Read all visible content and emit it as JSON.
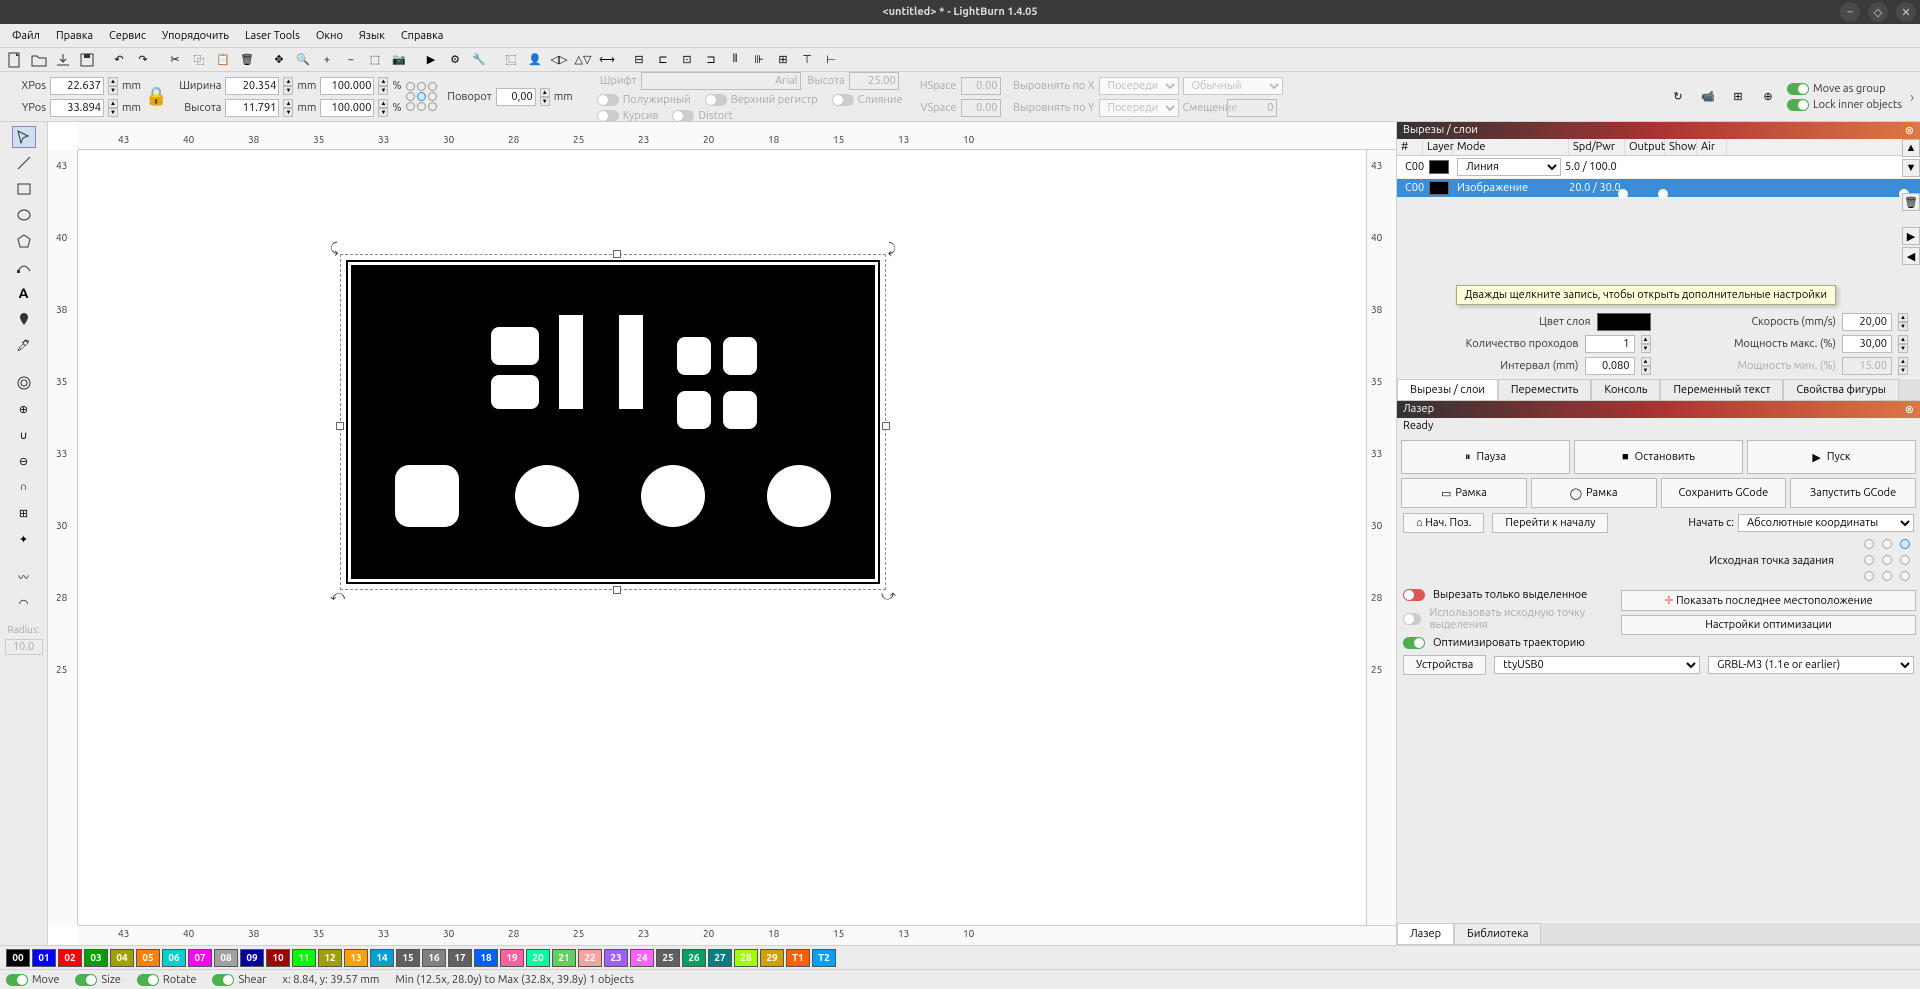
{
  "window": {
    "title": "<untitled> * - LightBurn 1.4.05"
  },
  "menu": [
    "Файл",
    "Правка",
    "Сервис",
    "Упорядочить",
    "Laser Tools",
    "Окно",
    "Язык",
    "Справка"
  ],
  "position": {
    "xpos_label": "XPos",
    "xpos": "22.637",
    "xunit": "mm",
    "ypos_label": "YPos",
    "ypos": "33.894",
    "yunit": "mm",
    "width_label": "Ширина",
    "width": "20.354",
    "wunit": "mm",
    "wpct": "100.000",
    "height_label": "Высота",
    "height": "11.791",
    "hunit": "mm",
    "hpct": "100.000",
    "rotate_label": "Поворот",
    "rotate": "0,00",
    "runit": "mm"
  },
  "font": {
    "label": "Шрифт",
    "family": "Arial",
    "size_label": "Высота",
    "size": "25.00",
    "bold": "Полужирный",
    "italic": "Курсив",
    "upper": "Верхний регистр",
    "weld": "Слияние",
    "distort": "Distort",
    "hspace": "HSpace",
    "hspace_v": "0.00",
    "alignx": "Выровнять по X",
    "alignx_v": "Посередине",
    "style": "Обычный",
    "vspace": "VSpace",
    "vspace_v": "0.00",
    "aligny": "Выровнять по Y",
    "aligny_v": "Посередине",
    "offset": "Смещение",
    "offset_v": "0"
  },
  "movegroup": "Move as group",
  "lockinner": "Lock inner objects",
  "ruler_ticks_h": [
    "43",
    "40",
    "38",
    "35",
    "33",
    "30",
    "28",
    "25",
    "23",
    "20",
    "18",
    "15",
    "13",
    "10"
  ],
  "ruler_ticks_v": [
    "43",
    "40",
    "38",
    "35",
    "33",
    "30",
    "28",
    "25"
  ],
  "radius_label": "Radius:",
  "radius_val": "10.0",
  "cuts": {
    "title": "Вырезы / слои",
    "headers": {
      "num": "#",
      "layer": "Layer",
      "mode": "Mode",
      "spd": "Spd/Pwr",
      "output": "Output",
      "show": "Show",
      "air": "Air"
    },
    "rows": [
      {
        "num": "C00",
        "layer": "00",
        "mode": "Линия",
        "spd": "5.0 / 100.0"
      },
      {
        "num": "C00",
        "layer": "00",
        "mode": "Изображение",
        "spd": "20.0 / 30.0"
      }
    ],
    "tooltip": "Дважды щелкните запись, чтобы открыть дополнительные настройки",
    "params": {
      "layercolor": "Цвет слоя",
      "speed": "Скорость (mm/s)",
      "speed_v": "20,00",
      "passes": "Количество проходов",
      "passes_v": "1",
      "pwrmax": "Мощность макс. (%)",
      "pwrmax_v": "30,00",
      "interval": "Интервал (mm)",
      "interval_v": "0.080",
      "pwrmin": "Мощность мин. (%)",
      "pwrmin_v": "15.00"
    },
    "tabs": [
      "Вырезы / слои",
      "Переместить",
      "Консоль",
      "Переменный текст",
      "Свойства фигуры"
    ]
  },
  "laser": {
    "title": "Лазер",
    "status": "Ready",
    "pause": "Пауза",
    "stop": "Остановить",
    "start": "Пуск",
    "frame": "Рамка",
    "save_gcode": "Сохранить GCode",
    "run_gcode": "Запустить GCode",
    "home": "Нач. Поз.",
    "gotoorigin": "Перейти к началу",
    "startfrom": "Начать с:",
    "startfrom_v": "Абсолютные координаты",
    "job_origin": "Исходная точка задания",
    "cutsel": "Вырезать только выделенное",
    "useorigin": "Использовать исходную точку выделения",
    "opt": "Оптимизировать траекторию",
    "showlast": "Показать последнее местоположение",
    "optset": "Настройки оптимизации",
    "devices": "Устройства",
    "port": "ttyUSB0",
    "profile": "GRBL-M3 (1.1e or earlier)",
    "bottom_tabs": [
      "Лазер",
      "Библиотека"
    ]
  },
  "colorbar": [
    {
      "n": "00",
      "c": "#000000"
    },
    {
      "n": "01",
      "c": "#0000ff"
    },
    {
      "n": "02",
      "c": "#ff0000"
    },
    {
      "n": "03",
      "c": "#00a000"
    },
    {
      "n": "04",
      "c": "#a0a000"
    },
    {
      "n": "05",
      "c": "#ff8000"
    },
    {
      "n": "06",
      "c": "#00d0d0"
    },
    {
      "n": "07",
      "c": "#ff00ff"
    },
    {
      "n": "08",
      "c": "#a0a0a0"
    },
    {
      "n": "09",
      "c": "#0000a0"
    },
    {
      "n": "10",
      "c": "#a00000"
    },
    {
      "n": "11",
      "c": "#00ff00"
    },
    {
      "n": "12",
      "c": "#a0a000"
    },
    {
      "n": "13",
      "c": "#ffa000"
    },
    {
      "n": "14",
      "c": "#00a0d0"
    },
    {
      "n": "15",
      "c": "#606060"
    },
    {
      "n": "16",
      "c": "#808080"
    },
    {
      "n": "17",
      "c": "#606060"
    },
    {
      "n": "18",
      "c": "#0060ff"
    },
    {
      "n": "19",
      "c": "#ff60a0"
    },
    {
      "n": "20",
      "c": "#00ffa0"
    },
    {
      "n": "21",
      "c": "#60d060"
    },
    {
      "n": "22",
      "c": "#ffa0a0"
    },
    {
      "n": "23",
      "c": "#a060ff"
    },
    {
      "n": "24",
      "c": "#ff60ff"
    },
    {
      "n": "25",
      "c": "#606060"
    },
    {
      "n": "26",
      "c": "#00a060"
    },
    {
      "n": "27",
      "c": "#008080"
    },
    {
      "n": "28",
      "c": "#a0ff00"
    },
    {
      "n": "29",
      "c": "#d0a000"
    },
    {
      "n": "T1",
      "c": "#ff6000"
    },
    {
      "n": "T2",
      "c": "#00a0ff"
    }
  ],
  "status": {
    "move": "Move",
    "size": "Size",
    "rotate": "Rotate",
    "shear": "Shear",
    "xy": "x: 8.84, y: 39.57 mm",
    "bounds": "Min (12.5x, 28.0y) to Max (32.8x, 39.8y)  1 objects"
  }
}
